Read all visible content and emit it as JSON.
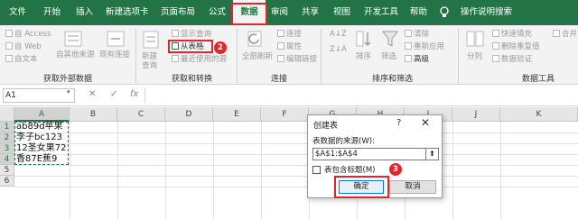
{
  "menu": {
    "tabs": [
      "文件",
      "开始",
      "插入",
      "新建选项卡",
      "页面布局",
      "公式",
      "数据",
      "审阅",
      "共享",
      "视图",
      "开发工具",
      "帮助"
    ],
    "active_tab": "数据",
    "tell_me": "操作说明搜索"
  },
  "ribbon": {
    "get_external": {
      "label": "获取外部数据",
      "access": "自 Access",
      "web": "自 Web",
      "text": "自文本",
      "other": "自其他来源",
      "existing": "现有连接"
    },
    "transform": {
      "label": "获取和转换",
      "new_query": "新建\n查询",
      "show_queries": "显示查询",
      "from_table": "从表格",
      "recent_sources": "最近使用的源"
    },
    "connections": {
      "label": "连接",
      "refresh_all": "全部刷新",
      "connections": "连接",
      "properties": "属性",
      "edit_links": "编辑链接"
    },
    "sort_filter": {
      "label": "排序和筛选",
      "sort_az": "A↓Z",
      "sort_za": "Z↓A",
      "sort": "排序",
      "filter": "筛选",
      "clear": "清除",
      "reapply": "重新应用",
      "advanced": "高级"
    },
    "data_tools": {
      "label": "数据工具",
      "split": "分列",
      "flash_fill": "快速填充",
      "remove_dup": "删除重复值",
      "validation": "数据验证"
    },
    "cut_right": "合并"
  },
  "formula_bar": {
    "name_box": "A1",
    "cancel": "✕",
    "enter": "✓",
    "fx": "fx",
    "value": ""
  },
  "grid": {
    "columns": [
      "A",
      "B",
      "C",
      "D",
      "E",
      "F",
      "G",
      "H",
      "I",
      "J",
      "K"
    ],
    "rows": [
      "1",
      "2",
      "3",
      "4",
      "5",
      "6"
    ],
    "cells": [
      "ab89d苹果",
      "李子bc123",
      "12圣女果72",
      "香87E蕉9"
    ]
  },
  "dialog": {
    "title": "创建表",
    "help": "?",
    "close": "✕",
    "source_label": "表数据的来源(W):",
    "source_value": "$A$1:$A$4",
    "collapse": "⬆",
    "has_headers": "表包含标题(M)",
    "has_headers_checked": false,
    "ok": "确定",
    "cancel": "取消"
  },
  "badges": [
    "1",
    "2",
    "3"
  ],
  "colors": {
    "brand": "#227447",
    "highlight": "#e3262b",
    "ok_border": "#0078d7"
  }
}
